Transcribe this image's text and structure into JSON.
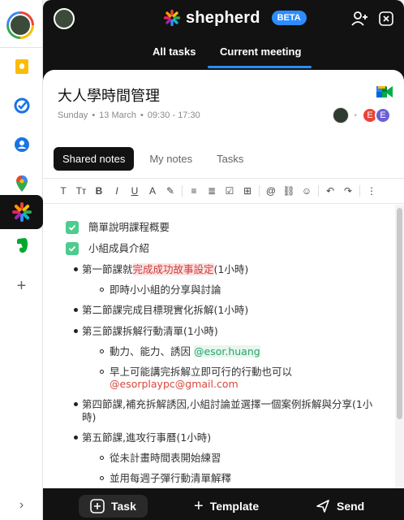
{
  "rail": {
    "items": [
      "keep-icon",
      "tasks-icon",
      "contacts-icon",
      "maps-icon",
      "shepherd-icon",
      "evernote-icon",
      "add-icon"
    ],
    "bottom_label": "›"
  },
  "header": {
    "brand": "shepherd",
    "beta": "BETA"
  },
  "tabs": {
    "all_tasks": "All tasks",
    "current_meeting": "Current meeting"
  },
  "meeting": {
    "title": "大人學時間管理",
    "day": "Sunday",
    "date": "13 March",
    "time": "09:30 - 17:30",
    "sep": "•",
    "attendees": [
      "E",
      "E"
    ]
  },
  "note_tabs": {
    "shared": "Shared notes",
    "mine": "My notes",
    "tasks": "Tasks"
  },
  "toolbar": [
    "T",
    "Tт",
    "B",
    "I",
    "U",
    "A",
    "✎",
    "≡",
    "≣",
    "☑",
    "⊞",
    "@",
    "⛓",
    "☺",
    "↶",
    "↷",
    "⋮"
  ],
  "notes": {
    "c1": "簡單說明課程概要",
    "c2": "小組成員介紹",
    "b1_pre": "第一節課就",
    "b1_hl": "完成成功故事設定",
    "b1_post": "(1小時)",
    "b1_sub": "即時小小組的分享與討論",
    "b2": "第二節課完成目標現實化拆解(1小時)",
    "b3": "第三節課拆解行動清單(1小時)",
    "b3_s1": "動力、能力、誘因",
    "b3_s1_mention": "@esor.huang",
    "b3_s2": "早上可能講完拆解立即可行的行動也可以",
    "b3_s2_mention": "@esorplaypc@gmail.com",
    "b4": "第四節課,補充拆解誘因,小組討論並選擇一個案例拆解與分享(1小",
    "b4_cont": "時)",
    "b5": "第五節課,進攻行事曆(1小時)",
    "b5_s1": "從未計畫時間表開始練習",
    "b5_s2": "並用每週子彈行動清單解釋"
  },
  "bottom": {
    "task": "Task",
    "template": "Template",
    "send": "Send"
  },
  "colors": {
    "panel": "#121212",
    "accent": "#2d8cff",
    "check": "#4ecb8f"
  }
}
